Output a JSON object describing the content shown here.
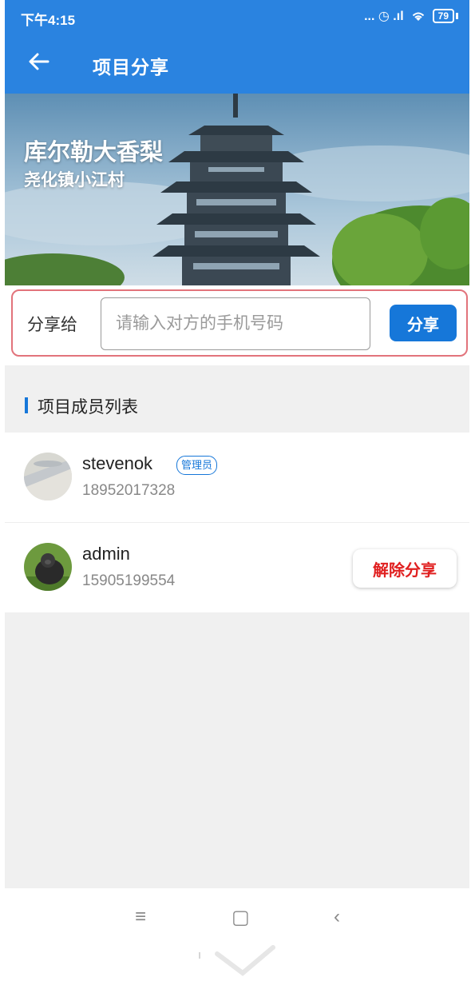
{
  "status_bar": {
    "time": "下午4:15",
    "signal_icons": "... ◷ .ıl",
    "battery": "79"
  },
  "app_bar": {
    "title": "项目分享",
    "back_icon": "arrow-left-icon"
  },
  "banner": {
    "project_name": "库尔勒大香梨",
    "location": "尧化镇小江村"
  },
  "share": {
    "label": "分享给",
    "placeholder": "请输入对方的手机号码",
    "value": "",
    "button_label": "分享"
  },
  "members_section": {
    "title": "项目成员列表"
  },
  "members": [
    {
      "name": "stevenok",
      "badge": "管理员",
      "phone": "18952017328"
    },
    {
      "name": "admin",
      "phone": "15905199554",
      "action_label": "解除分享"
    }
  ],
  "nav": {
    "menu": "≡",
    "home": "▢",
    "back": "‹"
  },
  "colors": {
    "primary": "#2a83e0",
    "danger": "#e02020",
    "highlight_border": "#e2737b"
  }
}
